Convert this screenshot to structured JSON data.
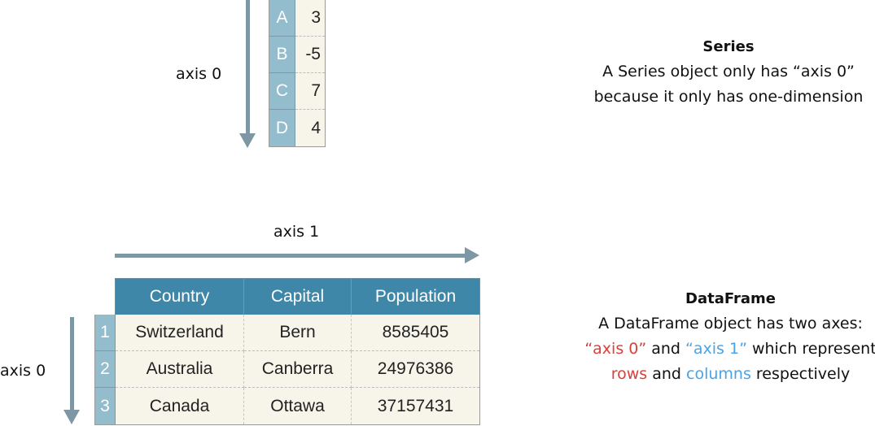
{
  "series_diagram": {
    "axis_label": "axis 0",
    "index": [
      "A",
      "B",
      "C",
      "D"
    ],
    "values": [
      "3",
      "-5",
      "7",
      "4"
    ]
  },
  "series_description": {
    "title": "Series",
    "line1": "A Series object only has “axis 0”",
    "line2": "because it only has one-dimension"
  },
  "dataframe_diagram": {
    "axis1_label": "axis 1",
    "axis0_label": "axis 0",
    "columns": [
      "Country",
      "Capital",
      "Population"
    ],
    "index": [
      "1",
      "2",
      "3"
    ],
    "rows": [
      [
        "Switzerland",
        "Bern",
        "8585405"
      ],
      [
        "Australia",
        "Canberra",
        "24976386"
      ],
      [
        "Canada",
        "Ottawa",
        "37157431"
      ]
    ]
  },
  "dataframe_description": {
    "title": "DataFrame",
    "line1": "A DataFrame object has two axes:",
    "line2_part1": "“axis 0”",
    "line2_part2": " and ",
    "line2_part3": "“axis 1”",
    "line2_part4": " which represent",
    "line3_part1": "rows",
    "line3_part2": " and ",
    "line3_part3": "columns",
    "line3_part4": " respectively",
    "colors": {
      "axis0_rows": "#d9403a",
      "axis1_columns": "#4aa3e6"
    }
  },
  "colors": {
    "header": "#3f87a8",
    "index": "#93bccc",
    "cell": "#f7f5ea",
    "arrow": "#7d97a5"
  }
}
